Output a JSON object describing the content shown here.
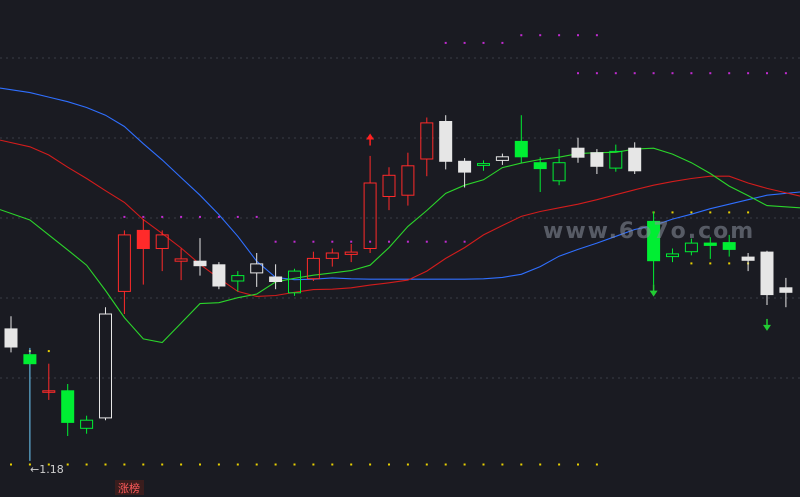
{
  "chart_data": {
    "type": "candlestick",
    "title": "",
    "xlabel": "",
    "ylabel": "",
    "ylim": [
      1.1,
      2.2
    ],
    "grid": true,
    "background": "#1a1b22",
    "colors": {
      "up": "#ff2a2a",
      "down_filled": "#00ee33",
      "hollow_white": "#e6e6e6",
      "ma_blue": "#2f6fff",
      "ma_red": "#d21c1c",
      "ma_green": "#2bd52b",
      "dot_magenta": "#c02bd0",
      "dot_yellow": "#e8d000",
      "arrow_up": "#ff2020",
      "arrow_down": "#22cc33"
    },
    "annotations": {
      "low_price_label": "←1.18",
      "tag_label": "涨榜",
      "watermark": "www.6o7o.com"
    },
    "candles": [
      {
        "i": 0,
        "open": 1.472,
        "high": 1.5,
        "low": 1.42,
        "close": 1.432,
        "style": "hollow_white"
      },
      {
        "i": 1,
        "open": 1.415,
        "high": 1.43,
        "low": 1.18,
        "close": 1.395,
        "style": "down_filled"
      },
      {
        "i": 2,
        "open": 1.335,
        "high": 1.395,
        "low": 1.315,
        "close": 1.335,
        "style": "up"
      },
      {
        "i": 3,
        "open": 1.335,
        "high": 1.35,
        "low": 1.235,
        "close": 1.265,
        "style": "down_filled"
      },
      {
        "i": 4,
        "open": 1.27,
        "high": 1.28,
        "low": 1.24,
        "close": 1.252,
        "style": "down_hollow"
      },
      {
        "i": 5,
        "open": 1.275,
        "high": 1.52,
        "low": 1.27,
        "close": 1.505,
        "style": "hollow_white"
      },
      {
        "i": 6,
        "open": 1.555,
        "high": 1.69,
        "low": 1.505,
        "close": 1.68,
        "style": "up"
      },
      {
        "i": 7,
        "open": 1.69,
        "high": 1.715,
        "low": 1.57,
        "close": 1.65,
        "style": "up_filled"
      },
      {
        "i": 8,
        "open": 1.68,
        "high": 1.69,
        "low": 1.6,
        "close": 1.65,
        "style": "up"
      },
      {
        "i": 9,
        "open": 1.627,
        "high": 1.65,
        "low": 1.58,
        "close": 1.622,
        "style": "up"
      },
      {
        "i": 10,
        "open": 1.622,
        "high": 1.673,
        "low": 1.59,
        "close": 1.612,
        "style": "hollow_white"
      },
      {
        "i": 11,
        "open": 1.614,
        "high": 1.62,
        "low": 1.56,
        "close": 1.567,
        "style": "hollow_white"
      },
      {
        "i": 12,
        "open": 1.59,
        "high": 1.6,
        "low": 1.555,
        "close": 1.578,
        "style": "down_hollow"
      },
      {
        "i": 13,
        "open": 1.596,
        "high": 1.64,
        "low": 1.565,
        "close": 1.616,
        "style": "hollow_white"
      },
      {
        "i": 14,
        "open": 1.587,
        "high": 1.615,
        "low": 1.56,
        "close": 1.577,
        "style": "hollow_white"
      },
      {
        "i": 15,
        "open": 1.6,
        "high": 1.605,
        "low": 1.545,
        "close": 1.552,
        "style": "down_hollow"
      },
      {
        "i": 16,
        "open": 1.583,
        "high": 1.643,
        "low": 1.578,
        "close": 1.628,
        "style": "up"
      },
      {
        "i": 17,
        "open": 1.628,
        "high": 1.65,
        "low": 1.61,
        "close": 1.64,
        "style": "up"
      },
      {
        "i": 18,
        "open": 1.637,
        "high": 1.66,
        "low": 1.62,
        "close": 1.642,
        "style": "up"
      },
      {
        "i": 19,
        "open": 1.65,
        "high": 1.855,
        "low": 1.64,
        "close": 1.795,
        "style": "up"
      },
      {
        "i": 20,
        "open": 1.765,
        "high": 1.83,
        "low": 1.735,
        "close": 1.812,
        "style": "up"
      },
      {
        "i": 21,
        "open": 1.768,
        "high": 1.862,
        "low": 1.745,
        "close": 1.833,
        "style": "up"
      },
      {
        "i": 22,
        "open": 1.848,
        "high": 1.94,
        "low": 1.81,
        "close": 1.928,
        "style": "up"
      },
      {
        "i": 23,
        "open": 1.931,
        "high": 1.945,
        "low": 1.825,
        "close": 1.843,
        "style": "hollow_white"
      },
      {
        "i": 24,
        "open": 1.843,
        "high": 1.85,
        "low": 1.785,
        "close": 1.819,
        "style": "hollow_white"
      },
      {
        "i": 25,
        "open": 1.838,
        "high": 1.845,
        "low": 1.822,
        "close": 1.834,
        "style": "down_hollow"
      },
      {
        "i": 26,
        "open": 1.845,
        "high": 1.86,
        "low": 1.835,
        "close": 1.853,
        "style": "hollow_white"
      },
      {
        "i": 27,
        "open": 1.887,
        "high": 1.945,
        "low": 1.84,
        "close": 1.853,
        "style": "down_filled"
      },
      {
        "i": 28,
        "open": 1.84,
        "high": 1.852,
        "low": 1.775,
        "close": 1.827,
        "style": "down_filled"
      },
      {
        "i": 29,
        "open": 1.84,
        "high": 1.87,
        "low": 1.79,
        "close": 1.8,
        "style": "down_hollow"
      },
      {
        "i": 30,
        "open": 1.872,
        "high": 1.895,
        "low": 1.84,
        "close": 1.852,
        "style": "hollow_white"
      },
      {
        "i": 31,
        "open": 1.862,
        "high": 1.87,
        "low": 1.815,
        "close": 1.832,
        "style": "hollow_white"
      },
      {
        "i": 32,
        "open": 1.865,
        "high": 1.88,
        "low": 1.82,
        "close": 1.828,
        "style": "down_hollow"
      },
      {
        "i": 33,
        "open": 1.872,
        "high": 1.885,
        "low": 1.815,
        "close": 1.822,
        "style": "hollow_white"
      },
      {
        "i": 34,
        "open": 1.71,
        "high": 1.732,
        "low": 1.57,
        "close": 1.623,
        "style": "down_filled"
      },
      {
        "i": 35,
        "open": 1.638,
        "high": 1.65,
        "low": 1.62,
        "close": 1.632,
        "style": "down_hollow"
      },
      {
        "i": 36,
        "open": 1.662,
        "high": 1.672,
        "low": 1.635,
        "close": 1.643,
        "style": "down_hollow"
      },
      {
        "i": 37,
        "open": 1.662,
        "high": 1.675,
        "low": 1.627,
        "close": 1.657,
        "style": "down_filled"
      },
      {
        "i": 38,
        "open": 1.663,
        "high": 1.68,
        "low": 1.632,
        "close": 1.648,
        "style": "down_filled"
      },
      {
        "i": 39,
        "open": 1.631,
        "high": 1.64,
        "low": 1.6,
        "close": 1.624,
        "style": "hollow_white"
      },
      {
        "i": 40,
        "open": 1.642,
        "high": 1.645,
        "low": 1.525,
        "close": 1.548,
        "style": "hollow_white"
      },
      {
        "i": 41,
        "open": 1.563,
        "high": 1.585,
        "low": 1.52,
        "close": 1.553,
        "style": "hollow_white"
      }
    ],
    "series": [
      {
        "key": "ma_blue",
        "values": [
          2.005,
          1.995,
          1.985,
          1.975,
          1.962,
          1.945,
          1.92,
          1.882,
          1.846,
          1.807,
          1.768,
          1.725,
          1.677,
          1.622,
          1.586,
          1.581,
          1.582,
          1.585,
          1.583,
          1.582,
          1.582,
          1.582,
          1.582,
          1.582,
          1.582,
          1.583,
          1.586,
          1.593,
          1.61,
          1.633,
          1.648,
          1.662,
          1.677,
          1.692,
          1.701,
          1.715,
          1.726,
          1.738,
          1.748,
          1.758,
          1.768,
          1.775
        ]
      },
      {
        "key": "ma_red",
        "values": [
          1.89,
          1.875,
          1.857,
          1.83,
          1.805,
          1.778,
          1.752,
          1.714,
          1.683,
          1.651,
          1.615,
          1.584,
          1.555,
          1.544,
          1.546,
          1.553,
          1.559,
          1.56,
          1.563,
          1.569,
          1.574,
          1.58,
          1.6,
          1.628,
          1.652,
          1.68,
          1.701,
          1.721,
          1.732,
          1.74,
          1.748,
          1.758,
          1.769,
          1.78,
          1.79,
          1.798,
          1.805,
          1.81,
          1.81,
          1.795,
          1.783,
          1.766
        ]
      },
      {
        "key": "ma_green",
        "values": [
          1.736,
          1.713,
          1.68,
          1.647,
          1.613,
          1.557,
          1.497,
          1.45,
          1.442,
          1.485,
          1.528,
          1.53,
          1.541,
          1.549,
          1.576,
          1.584,
          1.591,
          1.596,
          1.601,
          1.613,
          1.652,
          1.699,
          1.734,
          1.772,
          1.79,
          1.802,
          1.829,
          1.839,
          1.847,
          1.852,
          1.86,
          1.862,
          1.863,
          1.87,
          1.872,
          1.859,
          1.84,
          1.816,
          1.788,
          1.767,
          1.745,
          1.74
        ]
      }
    ],
    "dot_rows": [
      {
        "color_key": "dot_magenta",
        "y": 2.122,
        "from": 27,
        "to": 31,
        "step": 1
      },
      {
        "color_key": "dot_magenta",
        "y": 2.105,
        "from": 23,
        "to": 26,
        "step": 1
      },
      {
        "color_key": "dot_magenta",
        "y": 2.038,
        "from": 30,
        "to": 41,
        "step": 1
      },
      {
        "color_key": "dot_magenta",
        "y": 1.72,
        "from": 6,
        "to": 13,
        "step": 1
      },
      {
        "color_key": "dot_magenta",
        "y": 1.665,
        "from": 14,
        "to": 24,
        "step": 1
      },
      {
        "color_key": "dot_yellow",
        "y": 1.172,
        "from": 0,
        "to": 31,
        "step": 1
      },
      {
        "color_key": "dot_yellow",
        "y": 1.423,
        "from": 1,
        "to": 2,
        "step": 1
      },
      {
        "color_key": "dot_yellow",
        "y": 1.73,
        "from": 34,
        "to": 39,
        "step": 1
      },
      {
        "color_key": "dot_yellow",
        "y": 1.617,
        "from": 36,
        "to": 40,
        "step": 1
      }
    ],
    "arrows": [
      {
        "i": 19,
        "y": 1.9,
        "dir": "up",
        "color_key": "arrow_up"
      },
      {
        "i": 34,
        "y": 1.548,
        "dir": "down",
        "color_key": "arrow_down"
      },
      {
        "i": 40,
        "y": 1.472,
        "dir": "down",
        "color_key": "arrow_down"
      }
    ]
  }
}
